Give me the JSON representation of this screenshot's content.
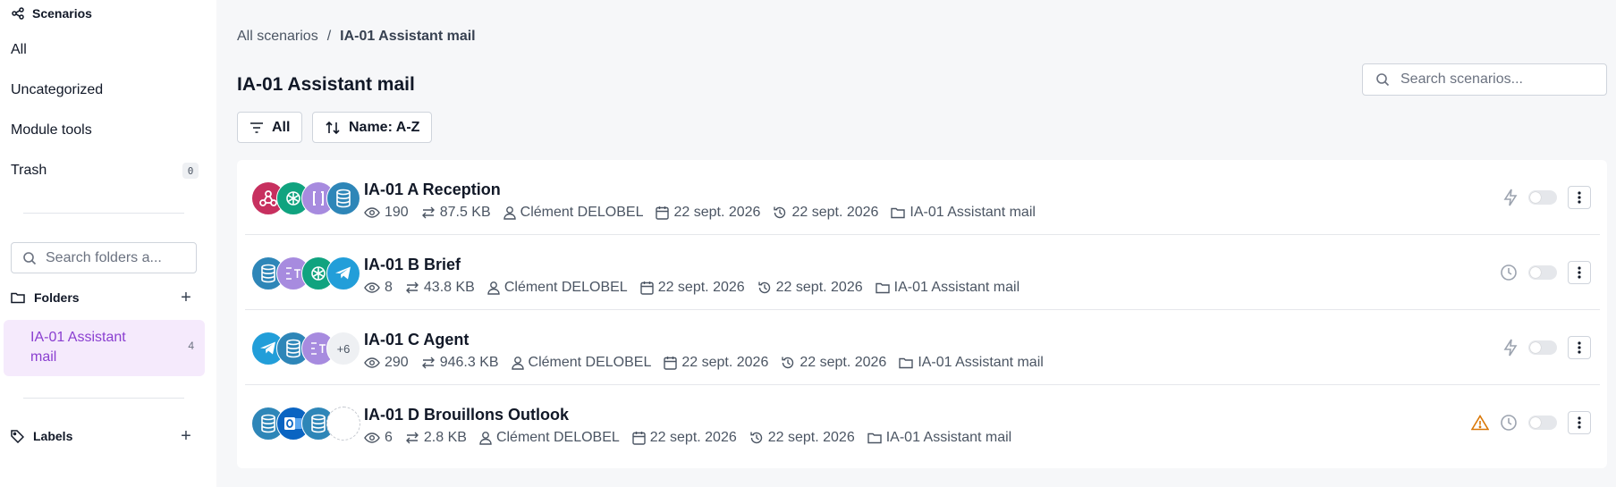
{
  "sidebar": {
    "title": "Scenarios",
    "items": [
      {
        "label": "All"
      },
      {
        "label": "Uncategorized"
      },
      {
        "label": "Module tools"
      },
      {
        "label": "Trash",
        "count": "0"
      }
    ],
    "folder_search_placeholder": "Search folders a...",
    "folders_label": "Folders",
    "folders": [
      {
        "name": "IA-01 Assistant mail",
        "count": "4"
      }
    ],
    "labels_label": "Labels"
  },
  "header": {
    "breadcrumb_root": "All scenarios",
    "breadcrumb_sep": "/",
    "breadcrumb_current": "IA-01 Assistant mail",
    "title": "IA-01 Assistant mail",
    "search_placeholder": "Search scenarios...",
    "filter_label": "All",
    "sort_label": "Name: A-Z"
  },
  "colors": {
    "accent": "#8a3fd0",
    "active_bg": "#f5eafc",
    "warning": "#d97706"
  },
  "scenarios": [
    {
      "name": "IA-01 A Reception",
      "views": "190",
      "transfer": "87.5 KB",
      "owner": "Clément DELOBEL",
      "created": "22 sept. 2026",
      "updated": "22 sept. 2026",
      "folder": "IA-01 Assistant mail",
      "apps": [
        "webhooks-icon",
        "openai-icon",
        "json-icon",
        "datastore-icon"
      ],
      "trigger": "instant-bolt-icon",
      "warning": false
    },
    {
      "name": "IA-01 B Brief",
      "views": "8",
      "transfer": "43.8 KB",
      "owner": "Clément DELOBEL",
      "created": "22 sept. 2026",
      "updated": "22 sept. 2026",
      "folder": "IA-01 Assistant mail",
      "apps": [
        "datastore-icon",
        "text-parser-icon",
        "openai-icon",
        "telegram-icon"
      ],
      "trigger": "schedule-clock-icon",
      "warning": false
    },
    {
      "name": "IA-01 C Agent",
      "views": "290",
      "transfer": "946.3 KB",
      "owner": "Clément DELOBEL",
      "created": "22 sept. 2026",
      "updated": "22 sept. 2026",
      "folder": "IA-01 Assistant mail",
      "apps": [
        "telegram-icon",
        "datastore-icon",
        "text-parser-icon"
      ],
      "more_apps": "+6",
      "trigger": "instant-bolt-icon",
      "warning": false
    },
    {
      "name": "IA-01 D Brouillons Outlook",
      "views": "6",
      "transfer": "2.8 KB",
      "owner": "Clément DELOBEL",
      "created": "22 sept. 2026",
      "updated": "22 sept. 2026",
      "folder": "IA-01 Assistant mail",
      "apps": [
        "datastore-icon",
        "outlook-icon",
        "datastore-icon",
        "empty-slot-icon"
      ],
      "trigger": "schedule-clock-icon",
      "warning": true
    }
  ]
}
